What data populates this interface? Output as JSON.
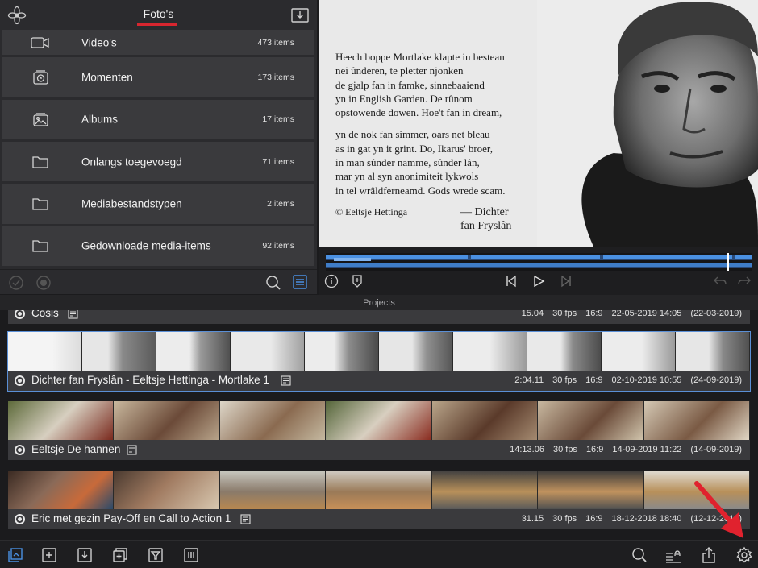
{
  "library": {
    "title": "Foto's",
    "items": [
      {
        "icon": "video-camera-icon",
        "label": "Video's",
        "count": "473 items"
      },
      {
        "icon": "moments-icon",
        "label": "Momenten",
        "count": "173 items"
      },
      {
        "icon": "albums-icon",
        "label": "Albums",
        "count": "17 items"
      },
      {
        "icon": "folder-icon",
        "label": "Onlangs toegevoegd",
        "count": "71 items"
      },
      {
        "icon": "folder-icon",
        "label": "Mediabestandstypen",
        "count": "2 items"
      },
      {
        "icon": "folder-icon",
        "label": "Gedownloade media-items",
        "count": "92 items"
      }
    ]
  },
  "viewer": {
    "poem_stanza1": [
      "Heech boppe Mortlake klapte in bestean",
      "nei ûnderen, te pletter njonken",
      "de gjalp fan in famke, sinnebaaiend",
      "yn in English Garden. De rûnom",
      "opstowende dowen. Hoe't fan in dream,"
    ],
    "poem_stanza2": [
      "yn de nok fan simmer, oars net bleau",
      "as in gat yn it grint. Do, Ikarus' broer,",
      "in man sûnder namme, sûnder lân,",
      "mar yn al syn anonimiteit lykwols",
      "in tel wrâldferneamd. Gods wrede scam."
    ],
    "credit": "© Eeltsje Hettinga",
    "signature_line1": "— Dichter",
    "signature_line2": "fan Fryslân"
  },
  "projects_title": "Projects",
  "projects": [
    {
      "name": "Cosis",
      "duration": "15.04",
      "fps": "30 fps",
      "ratio": "16:9",
      "modified": "22-05-2019 14:05",
      "created": "(22-03-2019)"
    },
    {
      "name": "Dichter fan Fryslân - Eeltsje Hettinga - Mortlake 1",
      "duration": "2:04.11",
      "fps": "30 fps",
      "ratio": "16:9",
      "modified": "02-10-2019 10:55",
      "created": "(24-09-2019)"
    },
    {
      "name": "Eeltsje De hannen",
      "duration": "14:13.06",
      "fps": "30 fps",
      "ratio": "16:9",
      "modified": "14-09-2019 11:22",
      "created": "(14-09-2019)"
    },
    {
      "name": "Eric met gezin Pay-Off en Call to Action 1",
      "duration": "31.15",
      "fps": "30 fps",
      "ratio": "16:9",
      "modified": "18-12-2018 18:40",
      "created": "(12-12-2018)"
    }
  ],
  "colors": {
    "accent_red": "#d8262f",
    "accent_blue": "#4a90e2",
    "selection_blue": "#5a8fd6"
  },
  "toolbar_icons": [
    "import-media-icon",
    "new-project-icon",
    "download-icon",
    "duplicate-icon",
    "filter-icon",
    "delete-icon",
    "search-icon",
    "sort-icon",
    "share-icon",
    "settings-icon"
  ]
}
